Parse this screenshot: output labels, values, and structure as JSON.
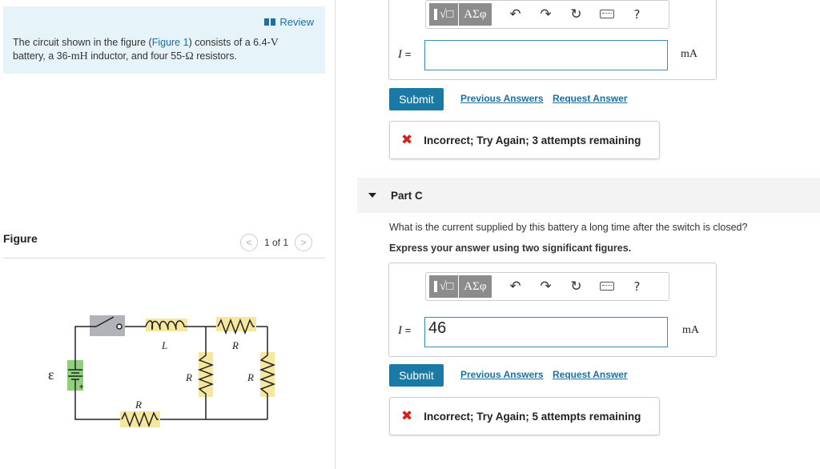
{
  "problem": {
    "review_label": "Review",
    "text_before": "The circuit shown in the figure (",
    "figure_link": "Figure 1",
    "text_mid1": ") consists of a 6.4-",
    "unit_v": "V",
    "text_mid2": " battery, a 36-",
    "unit_mh": "mH",
    "text_mid3": " inductor, and four 55-",
    "unit_ohm": "Ω",
    "text_end": " resistors."
  },
  "figure": {
    "title": "Figure",
    "pager_text": "1 of 1",
    "prev_icon": "<",
    "next_icon": ">",
    "labels": {
      "emf": "ε",
      "plus": "+",
      "inductor": "L",
      "r_top": "R",
      "r_mid1": "R",
      "r_mid2": "R",
      "r_bottom": "R"
    }
  },
  "part_b": {
    "toolbar": {
      "template": "√□",
      "greek": "ΑΣφ",
      "undo": "↶",
      "redo": "↷",
      "reset": "↻",
      "help": "?"
    },
    "variable": "I",
    "equals": "=",
    "input_value": "",
    "unit": "mA",
    "submit_label": "Submit",
    "previous_answers": "Previous Answers",
    "request_answer": "Request Answer",
    "feedback": "Incorrect; Try Again; 3 attempts remaining"
  },
  "part_c": {
    "title": "Part C",
    "question": "What is the current supplied by this battery a long time after the switch is closed?",
    "instruction": "Express your answer using two significant figures.",
    "toolbar": {
      "template": "√□",
      "greek": "ΑΣφ",
      "undo": "↶",
      "redo": "↷",
      "reset": "↻",
      "help": "?"
    },
    "variable": "I",
    "equals": "=",
    "input_value": "46",
    "unit": "mA",
    "submit_label": "Submit",
    "previous_answers": "Previous Answers",
    "request_answer": "Request Answer",
    "feedback": "Incorrect; Try Again; 5 attempts remaining"
  },
  "colors": {
    "problem_bg": "#e6f4fa",
    "link": "#1a6fa3",
    "submit_bg": "#1a7aa5",
    "error": "#d6201f",
    "component_bg": "#f5e6a0",
    "switch_bg": "#b0b4b8",
    "battery_bg": "#8fd07a"
  }
}
